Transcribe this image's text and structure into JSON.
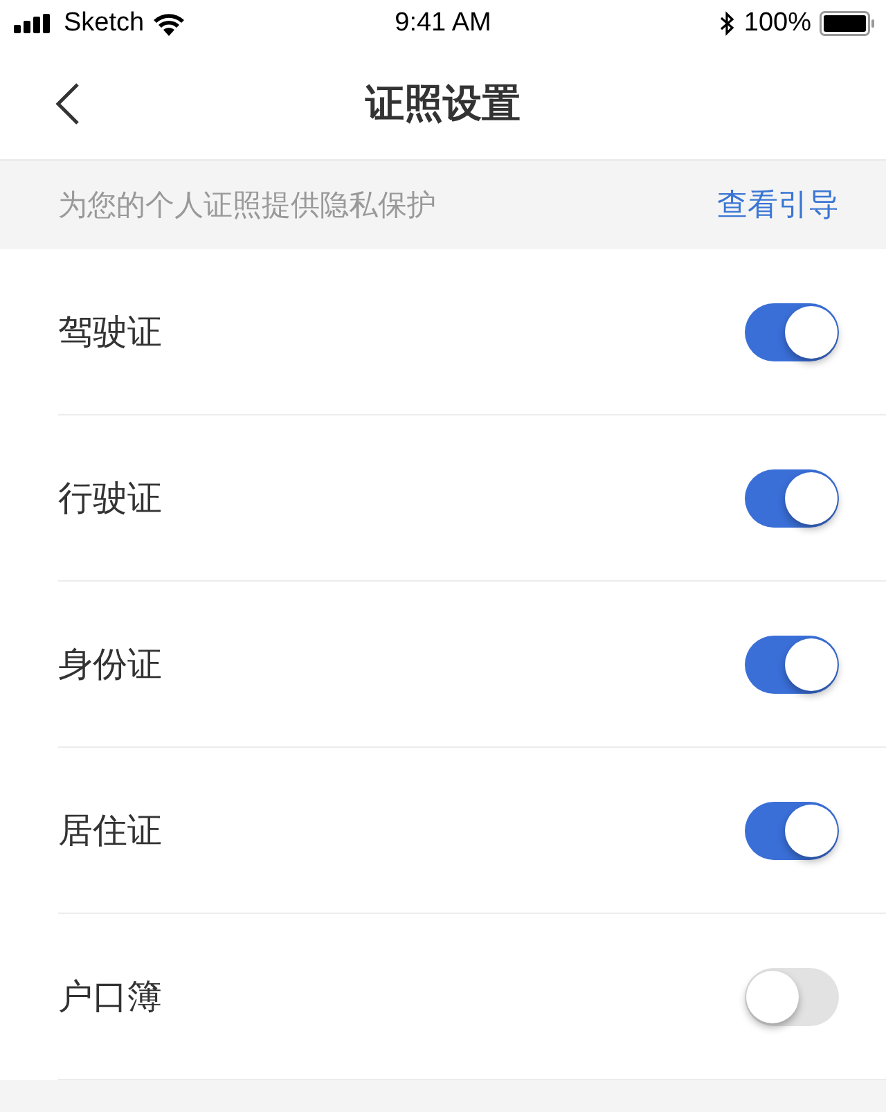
{
  "status_bar": {
    "carrier": "Sketch",
    "time": "9:41 AM",
    "battery": "100%"
  },
  "nav": {
    "title": "证照设置"
  },
  "banner": {
    "text": "为您的个人证照提供隐私保护",
    "link": "查看引导"
  },
  "items": [
    {
      "label": "驾驶证",
      "on": true
    },
    {
      "label": "行驶证",
      "on": true
    },
    {
      "label": "身份证",
      "on": true
    },
    {
      "label": "居住证",
      "on": true
    },
    {
      "label": "户口簿",
      "on": false
    }
  ]
}
